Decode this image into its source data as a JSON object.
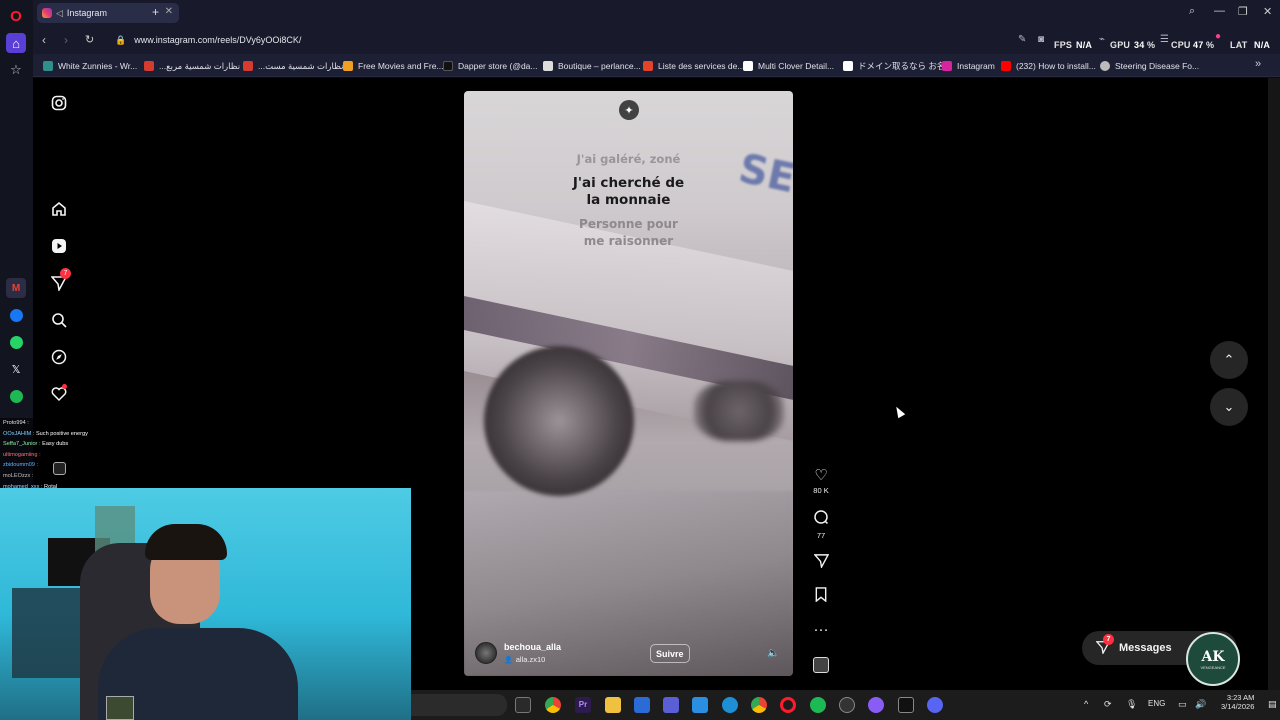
{
  "tab": {
    "title": "Instagram",
    "new_tab": "+"
  },
  "address": {
    "url": "www.instagram.com/reels/DVy6yOOi8CK/"
  },
  "perf": {
    "fps_label": "FPS",
    "fps_value": "N/A",
    "gpu_label": "GPU",
    "gpu_value": "34",
    "cpu_label": "CPU",
    "cpu_value": "47",
    "lat_label": "LAT",
    "lat_value": "N/A",
    "pct": "%"
  },
  "bookmarks": [
    {
      "label": "White Zunnies - Wr...",
      "color": "#2f8f8a"
    },
    {
      "label": "...نظارات شمسية مربع",
      "color": "#d63b2f"
    },
    {
      "label": "...نظارات شمسية مست",
      "color": "#d63b2f"
    },
    {
      "label": "Free Movies and Fre...",
      "color": "#f0a020"
    },
    {
      "label": "Dapper store (@da...",
      "color": "#111111"
    },
    {
      "label": "Boutique – perlance...",
      "color": "#dddddd"
    },
    {
      "label": "Liste des services de...",
      "color": "#e2432a"
    },
    {
      "label": "Multi Clover Detail...",
      "color": "#ffffff"
    },
    {
      "label": "ドメイン取るなら お名...",
      "color": "#ffffff"
    },
    {
      "label": "Instagram",
      "color": "#d6249f"
    },
    {
      "label": "(232) How to install...",
      "color": "#ff0000"
    },
    {
      "label": "Steering Disease Fo...",
      "color": "#bbbbbb"
    }
  ],
  "sidebar": {
    "notifications_badge": "7"
  },
  "reel": {
    "lyrics": {
      "line1": "J'ai galéré, zoné",
      "line2a": "J'ai cherché de",
      "line2b": "la monnaie",
      "line3a": "Personne pour",
      "line3b": "me raisonner"
    },
    "sign_text": "SE",
    "author": {
      "username": "bechoua_alla",
      "audio": "alla.zx10"
    },
    "follow_label": "Suivre"
  },
  "actions": {
    "likes": "80 K",
    "comments": "77"
  },
  "messages": {
    "label": "Messages",
    "badge": "7"
  },
  "chat": [
    {
      "user": "Proto994 :",
      "msg": "",
      "color": "#e0e0e0"
    },
    {
      "user": "OOxJAHIM :",
      "msg": "Such positive energy",
      "color": "#7fd2ff"
    },
    {
      "user": "Seffa7_Junior :",
      "msg": "Easy dubs",
      "color": "#8ff0a0"
    },
    {
      "user": "ultimogamiing :",
      "msg": "",
      "color": "#ff7070"
    },
    {
      "user": "zbidoumm09 :",
      "msg": "",
      "color": "#5fb0ff"
    },
    {
      "user": "moLEOzzx :",
      "msg": "",
      "color": "#c0c0c0"
    },
    {
      "user": "mohamed_xxx :",
      "msg": "Rotal",
      "color": "#9bd0ff"
    }
  ],
  "stream_logo": {
    "text": "AK",
    "sub": "VENGEANCE"
  },
  "taskbar": {
    "lang": "ENG",
    "time": "3:23 AM",
    "date": "3/14/2026"
  },
  "colors": {
    "accent_red": "#ff3040",
    "background": "#000000",
    "opera_red": "#ff1b2d"
  }
}
